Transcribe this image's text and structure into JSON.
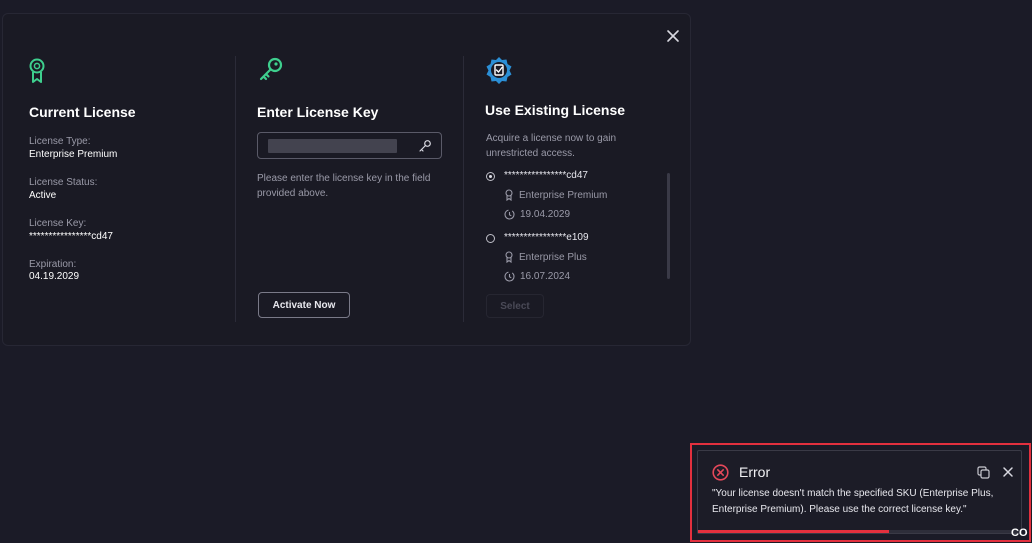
{
  "close_label": "×",
  "current_license": {
    "title": "Current License",
    "type_label": "License Type:",
    "type_value": "Enterprise Premium",
    "status_label": "License Status:",
    "status_value": "Active",
    "key_label": "License Key:",
    "key_value": "****************cd47",
    "expiration_label": "Expiration:",
    "expiration_value": "04.19.2029"
  },
  "enter_key": {
    "title": "Enter License Key",
    "input_value": "",
    "hint": "Please enter the license key in the field provided above.",
    "activate_label": "Activate Now"
  },
  "existing": {
    "title": "Use Existing License",
    "description": "Acquire a license now to gain unrestricted access.",
    "licenses": [
      {
        "key": "****************cd47",
        "edition": "Enterprise Premium",
        "date": "19.04.2029",
        "selected": true
      },
      {
        "key": "****************e109",
        "edition": "Enterprise Plus",
        "date": "16.07.2024",
        "selected": false
      }
    ],
    "select_label": "Select"
  },
  "toast": {
    "title": "Error",
    "message": "\"Your license doesn't match the specified SKU (Enterprise Plus, Enterprise Premium). Please use the correct license key.\"",
    "progress_percent": 59
  },
  "corner_label": "CO",
  "colors": {
    "accent_green": "#3ecf8e",
    "error_red": "#e3303e",
    "background": "#1b1b27"
  }
}
